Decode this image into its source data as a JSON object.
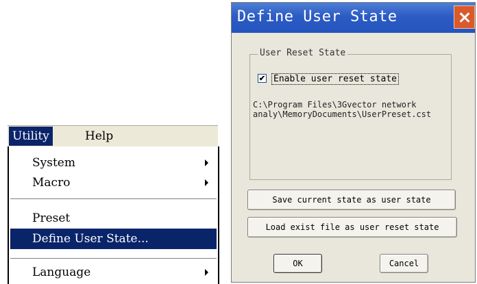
{
  "menubar": {
    "utility_label": "Utility",
    "help_label": "Help"
  },
  "utility_menu": {
    "items": [
      {
        "label": "System",
        "has_submenu": true
      },
      {
        "label": "Macro",
        "has_submenu": true
      },
      {
        "label": "Preset",
        "has_submenu": false
      },
      {
        "label": "Define User State...",
        "has_submenu": false,
        "highlighted": true
      },
      {
        "label": "Language",
        "has_submenu": true
      }
    ]
  },
  "dialog": {
    "title": "Define User State",
    "close_icon": "close-icon",
    "group_title": "User Reset State",
    "checkbox_label": "Enable user reset state",
    "checkbox_checked": true,
    "file_path": "C:\\Program Files\\3Gvector network analy\\MemoryDocuments\\UserPreset.cst",
    "save_button": "Save current state as user state",
    "load_button": "Load exist file as user reset state",
    "ok_button": "OK",
    "cancel_button": "Cancel"
  },
  "colors": {
    "title_bar": "#2c5bc4",
    "menu_highlight": "#0a246a",
    "close_button": "#d95a2b"
  }
}
